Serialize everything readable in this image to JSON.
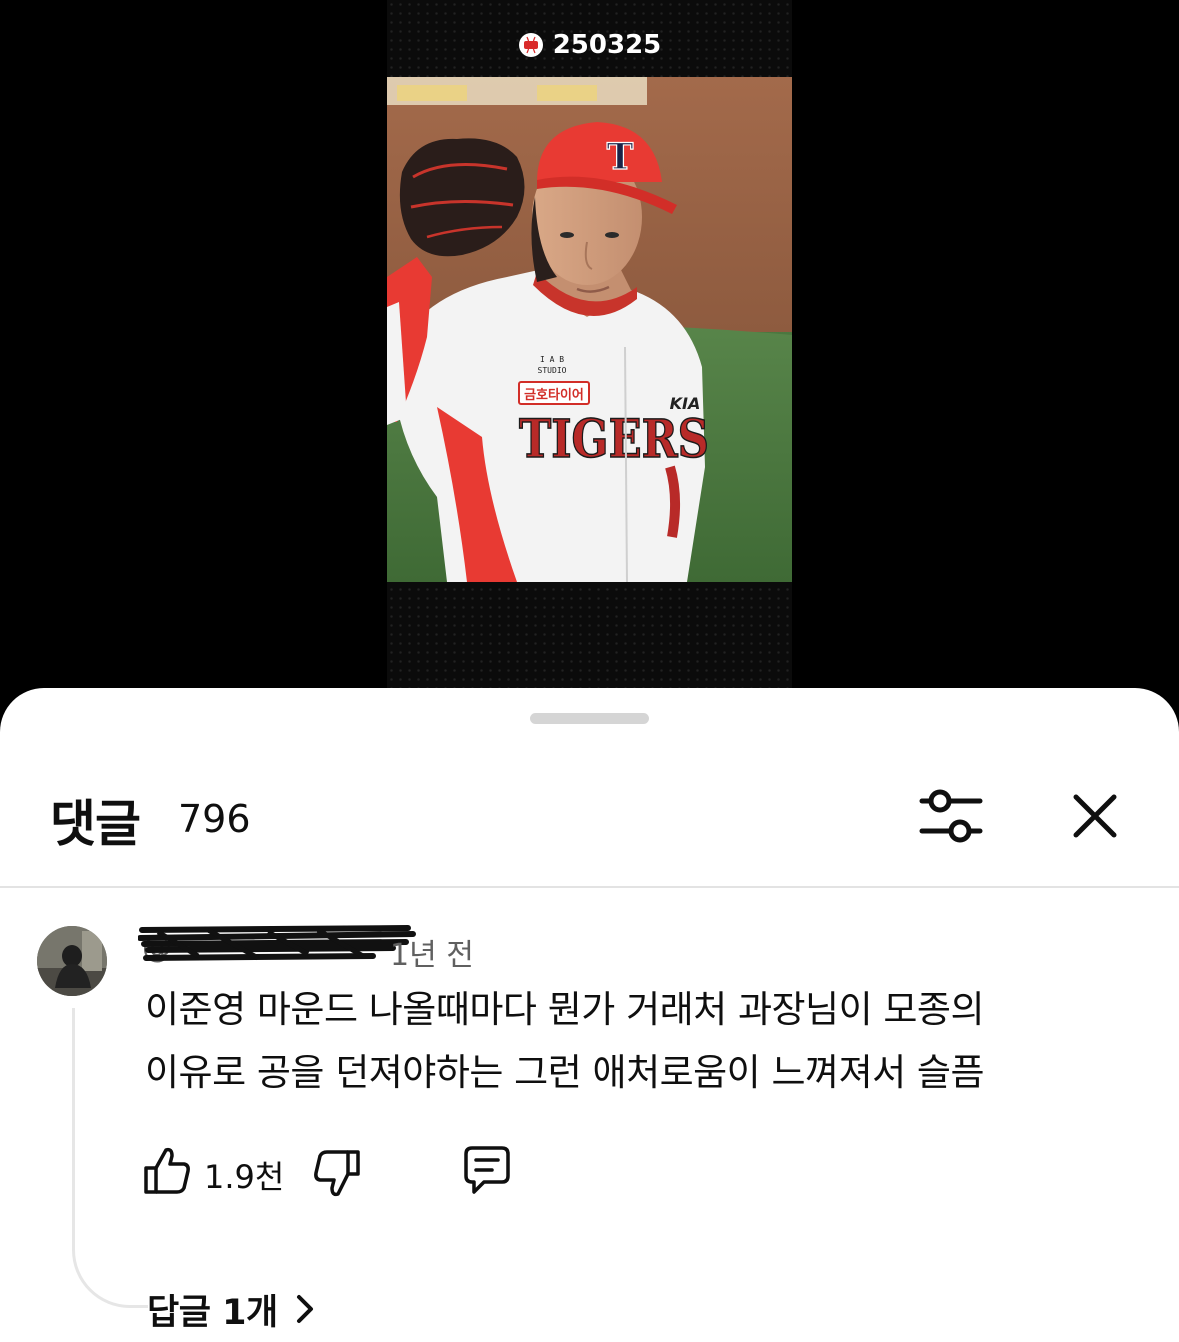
{
  "video": {
    "title": "250325",
    "title_icon": "baseball-icon",
    "frame": {
      "cap_letter": "T",
      "chest_logo_top": "I A B",
      "chest_logo_bottom": "STUDIO",
      "sponsor_patch": "금호타이어",
      "team_name": "TIGERS",
      "sleeve_brand": "KIA"
    }
  },
  "sheet": {
    "title": "댓글",
    "count": "796",
    "filter_icon": "sliders-icon",
    "close_icon": "close-icon"
  },
  "comment": {
    "author": "@",
    "timestamp": "1년 전",
    "text_lines": [
      "이준영 마운드 나올때마다 뭔가 거래처 과장님이 모종의",
      "이유로 공을 던져야하는 그런 애처로움이 느껴져서 슬픔"
    ],
    "likes": "1.9천",
    "replies_label": "답글 1개"
  },
  "colors": {
    "sheet_bg": "#ffffff",
    "text_primary": "#0f0f0f",
    "text_secondary": "#606060",
    "jersey_red": "#e83a33"
  }
}
